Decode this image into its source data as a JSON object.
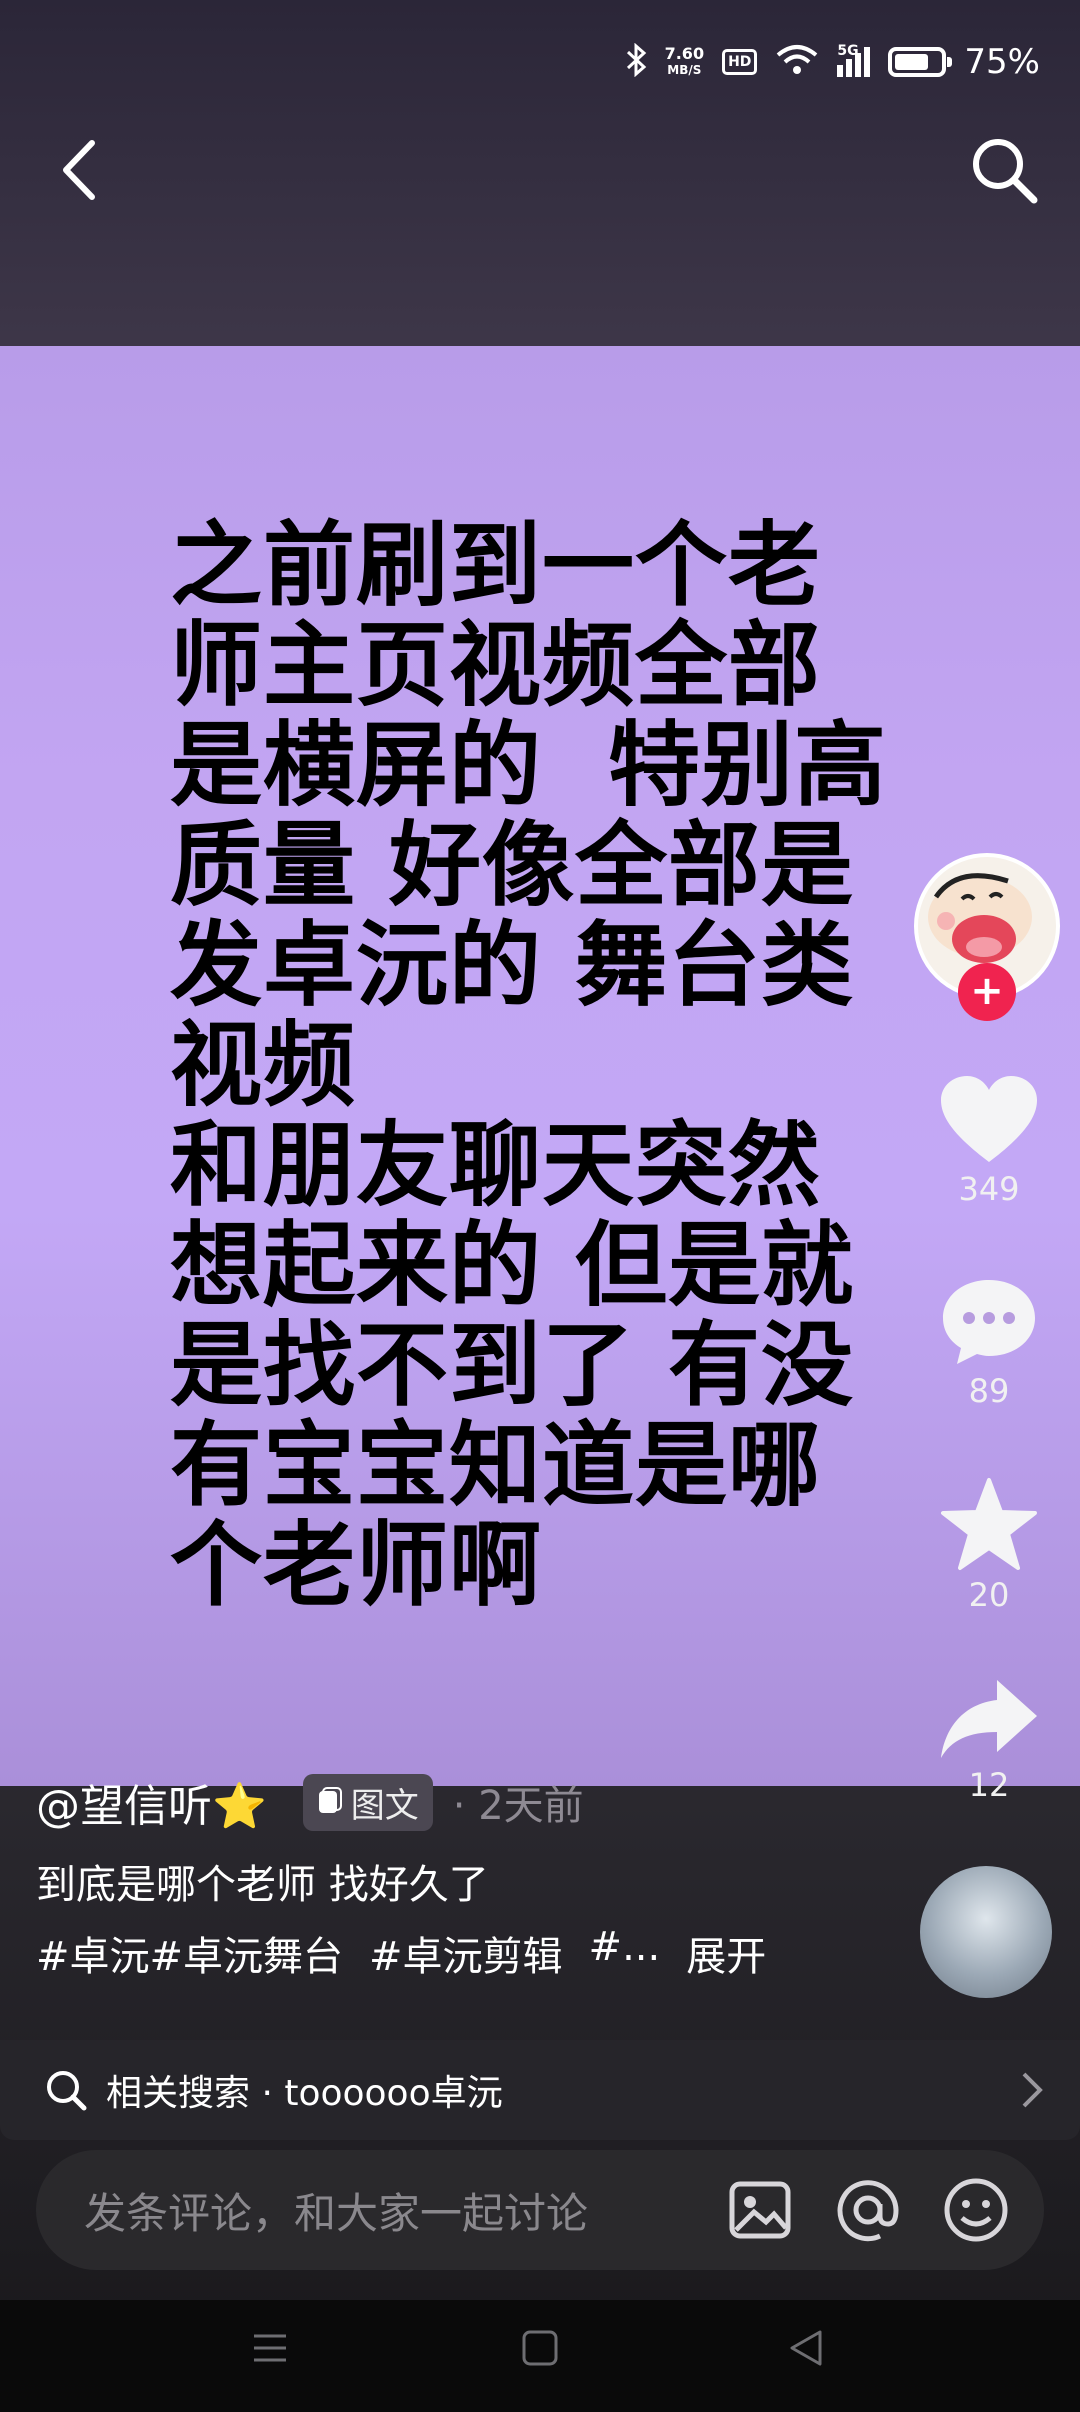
{
  "status_bar": {
    "net_speed": "7.60",
    "net_unit": "MB/S",
    "hd": "HD",
    "signal": "5G",
    "battery_pct": "75%",
    "battery_level": 0.75
  },
  "post": {
    "text": "之前刷到一个老\n师主页视频全部\n是横屏的  特别高\n质量 好像全部是\n发卓沅的 舞台类\n视频\n和朋友聊天突然\n想起来的 但是就\n是找不到了 有没\n有宝宝知道是哪\n个老师啊",
    "author": "@望信听⭐",
    "type_tag": "图文",
    "time": "· 2天前",
    "description": "到底是哪个老师 找好久了",
    "hashtags": [
      "#卓沅#卓沅舞台",
      "#卓沅剪辑",
      "#...",
      "展开"
    ]
  },
  "actions": {
    "likes": "349",
    "comments": "89",
    "favorites": "20",
    "shares": "12"
  },
  "related": {
    "label": "相关搜索 · toooooo卓沅"
  },
  "comment_bar": {
    "placeholder": "发条评论，和大家一起讨论"
  },
  "colors": {
    "card_purple": "#c3a8f6",
    "follow_red": "#f0234f"
  }
}
